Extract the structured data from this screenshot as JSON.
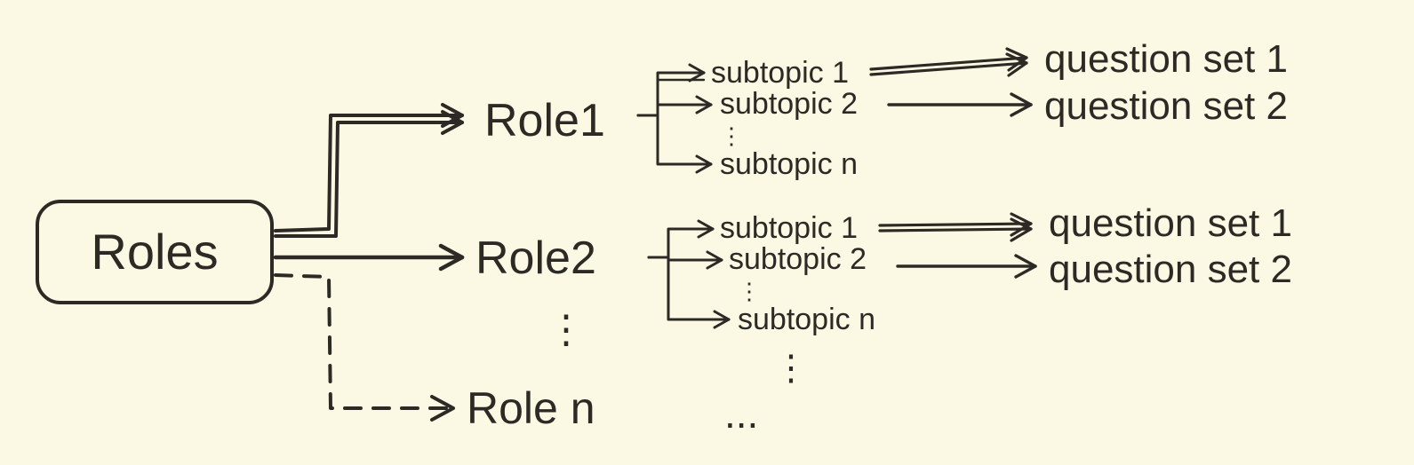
{
  "root": {
    "label": "Roles"
  },
  "roles": [
    {
      "label": "Role1"
    },
    {
      "label": "Role2"
    },
    {
      "label": "Role n"
    }
  ],
  "role_ellipsis": "⋮",
  "subtopics_block1": [
    {
      "label": "subtopic 1"
    },
    {
      "label": "subtopic 2"
    },
    {
      "label": "subtopic n"
    }
  ],
  "subtopics_block1_ellipsis": "⋮",
  "subtopics_block2": [
    {
      "label": "subtopic 1"
    },
    {
      "label": "subtopic 2"
    },
    {
      "label": "subtopic n"
    }
  ],
  "subtopics_block2_ellipsis": "⋮",
  "subtopic_col_ellipsis": "⋮",
  "subtopic_row_ellipsis": "...",
  "question_sets_block1": [
    {
      "label": "question set 1"
    },
    {
      "label": "question set 2"
    }
  ],
  "question_sets_block2": [
    {
      "label": "question set 1"
    },
    {
      "label": "question set 2"
    }
  ]
}
